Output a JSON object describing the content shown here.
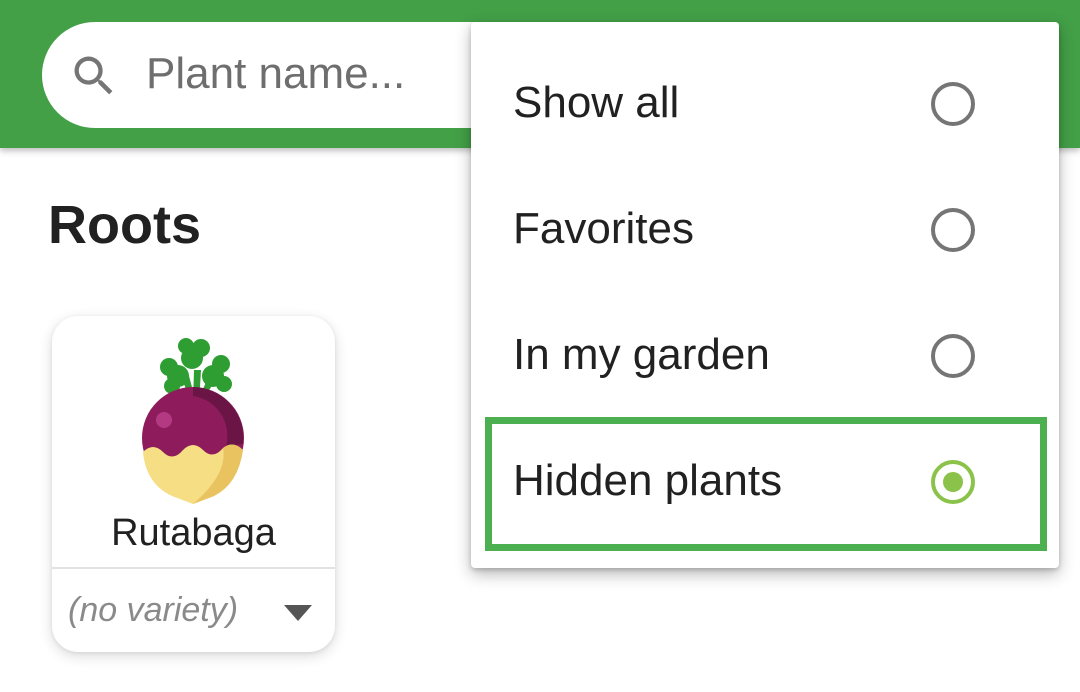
{
  "search": {
    "placeholder": "Plant name...",
    "value": "",
    "icon": "search-icon"
  },
  "section": {
    "title": "Roots"
  },
  "cards": [
    {
      "name": "Rutabaga",
      "variety": "(no variety)",
      "image_icon": "rutabaga-icon"
    }
  ],
  "filter_menu": {
    "selected": "Hidden plants",
    "items": [
      {
        "label": "Show all",
        "selected": false
      },
      {
        "label": "Favorites",
        "selected": false
      },
      {
        "label": "In my garden",
        "selected": false
      },
      {
        "label": "Hidden plants",
        "selected": true
      }
    ]
  },
  "colors": {
    "app_bar": "#43a047",
    "radio_selected": "#8bc34a",
    "radio_unselected": "#757575",
    "highlight": "#4caf50"
  }
}
